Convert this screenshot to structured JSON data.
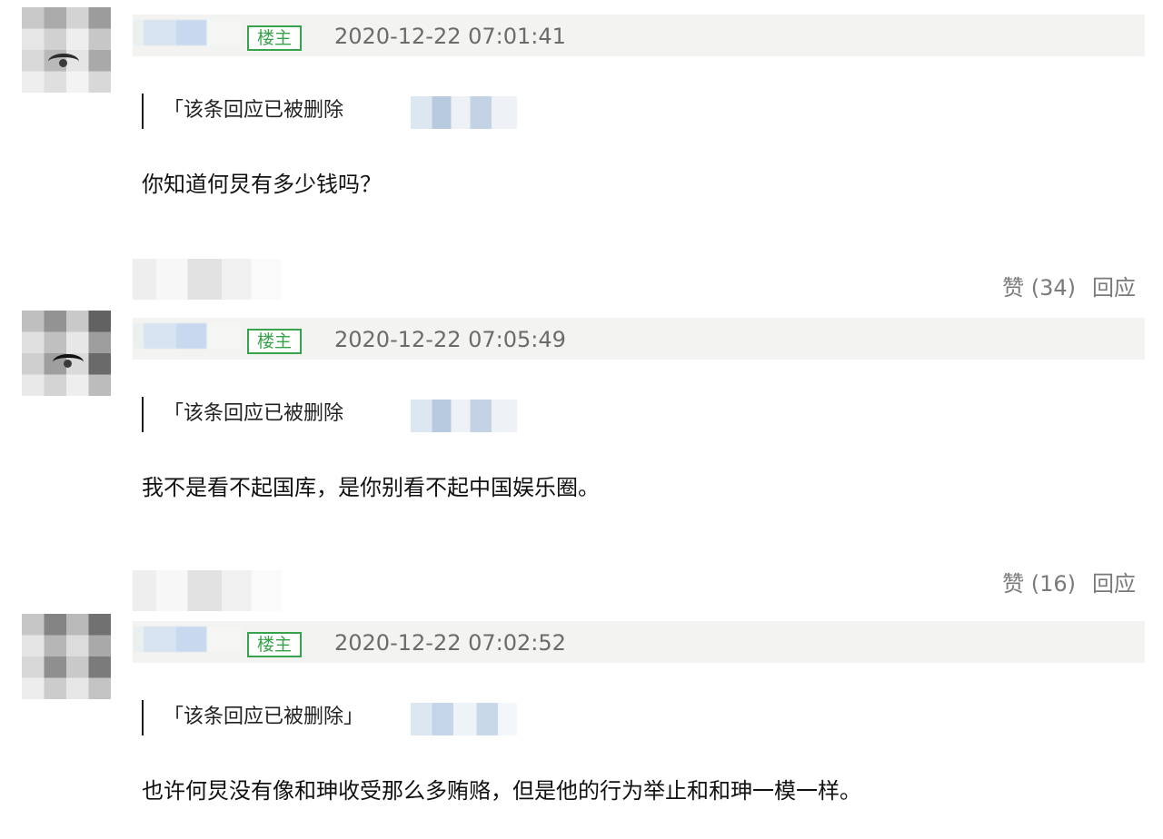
{
  "comments": [
    {
      "badge": "楼主",
      "timestamp": "2020-12-22 07:01:41",
      "quote": "「该条回应已被删除",
      "text": "你知道何炅有多少钱吗？",
      "like_label": "赞 (34)",
      "reply_label": "回应"
    },
    {
      "badge": "楼主",
      "timestamp": "2020-12-22 07:05:49",
      "quote": "「该条回应已被删除",
      "text": "我不是看不起国库，是你别看不起中国娱乐圈。",
      "like_label": "赞 (16)",
      "reply_label": "回应"
    },
    {
      "badge": "楼主",
      "timestamp": "2020-12-22 07:02:52",
      "quote": "「该条回应已被删除」",
      "text": "也许何炅没有像和珅收受那么多贿赂，但是他的行为举止和和珅一模一样。"
    }
  ]
}
